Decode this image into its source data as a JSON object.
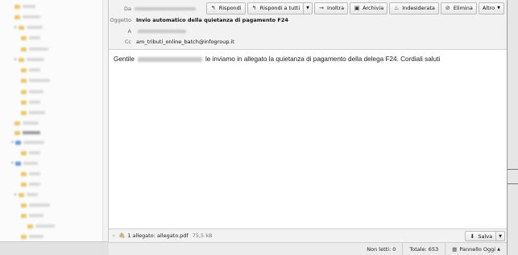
{
  "header": {
    "from_label": "Da",
    "subject_label": "Oggetto",
    "subject": "Invio automatico della quietanza di pagamento F24",
    "to_label": "A",
    "cc_label": "Cc",
    "cc": "am_tributi_online_batch@infogroup.it"
  },
  "toolbar": {
    "reply": "Rispondi",
    "reply_all": "Rispondi a tutti",
    "forward": "Inoltra",
    "archive": "Archivia",
    "junk": "Indesiderata",
    "delete": "Elimina",
    "more": "Altro"
  },
  "body": {
    "greeting": "Gentile",
    "text": "le inviamo in allegato la quietanza di pagamento della delega F24. Cordiali saluti"
  },
  "attachments": {
    "count_label": "1 allegato:",
    "filename": "allegato.pdf",
    "size": "75,5 kB",
    "save": "Salva"
  },
  "status": {
    "unread": "Non letti: 0",
    "total": "Totale: 653",
    "today_pane": "Pannello Oggi"
  },
  "colors": {
    "folder": "#e8c66a",
    "header_bg": "#f2f2f2",
    "pane_border": "#c9c9c9"
  }
}
